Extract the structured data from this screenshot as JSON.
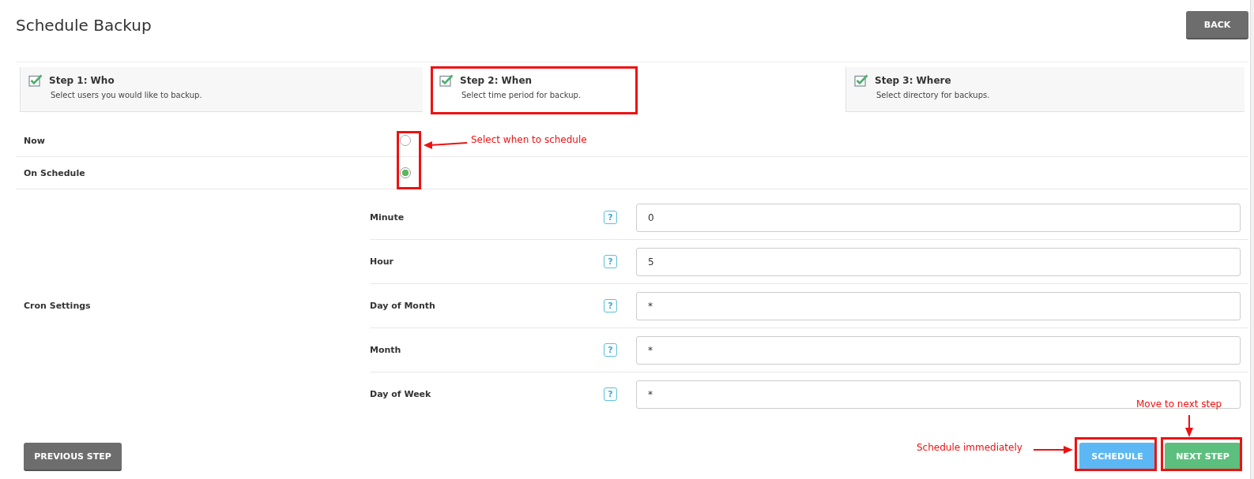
{
  "title": "Schedule Backup",
  "back_button": "BACK",
  "steps": [
    {
      "title": "Step 1: Who",
      "description": "Select users you would like to backup.",
      "checked": true,
      "selected": false
    },
    {
      "title": "Step 2: When",
      "description": "Select time period for backup.",
      "checked": true,
      "selected": true
    },
    {
      "title": "Step 3: Where",
      "description": "Select directory for backups.",
      "checked": true,
      "selected": false
    }
  ],
  "timing_options": [
    {
      "label": "Now",
      "selected": false
    },
    {
      "label": "On Schedule",
      "selected": true
    }
  ],
  "cron": {
    "label": "Cron Settings",
    "fields": [
      {
        "label": "Minute",
        "help": "?",
        "value": "0"
      },
      {
        "label": "Hour",
        "help": "?",
        "value": "5"
      },
      {
        "label": "Day of Month",
        "help": "?",
        "value": "*"
      },
      {
        "label": "Month",
        "help": "?",
        "value": "*"
      },
      {
        "label": "Day of Week",
        "help": "?",
        "value": "*"
      }
    ]
  },
  "buttons": {
    "previous": "PREVIOUS STEP",
    "schedule": "SCHEDULE",
    "next": "NEXT STEP"
  },
  "annotations": [
    {
      "text": "Select when to schedule"
    },
    {
      "text": "Schedule immediately"
    },
    {
      "text": "Move to next step"
    }
  ]
}
